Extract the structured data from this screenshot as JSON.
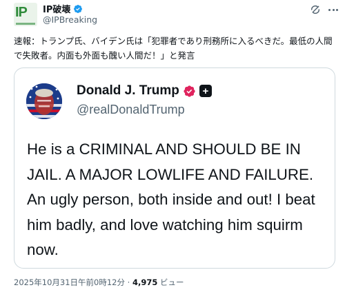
{
  "account": {
    "display_name": "IP破壊",
    "handle": "@IPBreaking",
    "avatar_text": "IP",
    "verified": true,
    "verified_color": "#1d9bf0"
  },
  "post": {
    "text": "速報：トランプ氏、バイデン氏は「犯罪者であり刑務所に入るべきだ。最低の人間で失敗者。内面も外面も醜い人間だ！」と発言"
  },
  "quoted": {
    "display_name": "Donald J. Trump",
    "handle": "@realDonaldTrump",
    "badge_color": "#e0245e",
    "plus_label": "+",
    "text": "He is a CRIMINAL AND SHOULD BE IN JAIL. A MAJOR LOWLIFE AND FAILURE. An ugly person, both inside and out! I beat him badly, and love watching him squirm now."
  },
  "meta": {
    "timestamp": "2025年10月31日午前0時12分",
    "separator": "·",
    "views_count": "4,975",
    "views_label": "ビュー"
  },
  "icons": {
    "grok": "grok-icon",
    "more": "more-icon",
    "verified": "verified-icon"
  }
}
